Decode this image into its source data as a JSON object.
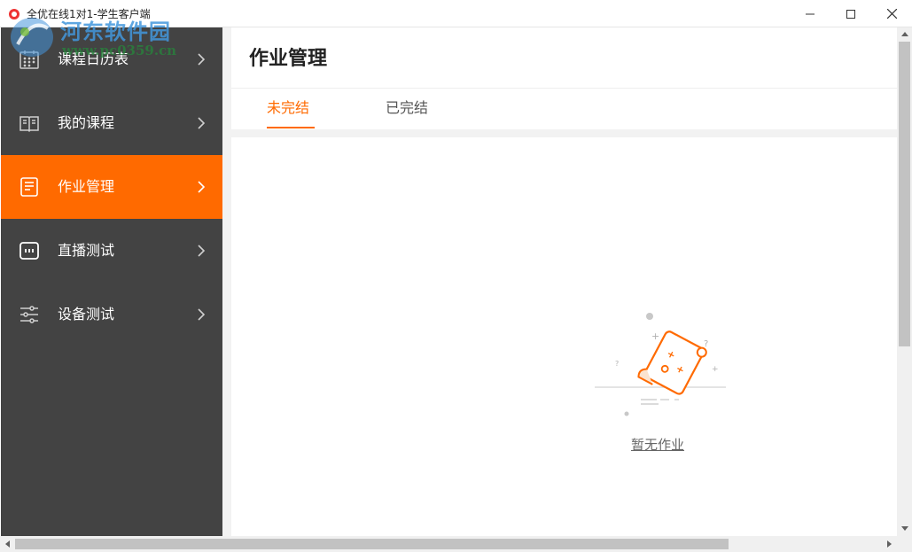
{
  "window": {
    "title": "全优在线1对1-学生客户端"
  },
  "watermark": {
    "name": "河东软件园",
    "url": "www.pc0359.cn"
  },
  "sidebar": {
    "items": [
      {
        "label": "课程日历表",
        "icon": "calendar-icon",
        "active": false
      },
      {
        "label": "我的课程",
        "icon": "book-icon",
        "active": false
      },
      {
        "label": "作业管理",
        "icon": "homework-icon",
        "active": true
      },
      {
        "label": "直播测试",
        "icon": "live-icon",
        "active": false
      },
      {
        "label": "设备测试",
        "icon": "sliders-icon",
        "active": false
      }
    ]
  },
  "main": {
    "title": "作业管理",
    "tabs": [
      {
        "label": "未完结",
        "active": true
      },
      {
        "label": "已完结",
        "active": false
      }
    ],
    "empty_text": "暂无作业"
  },
  "colors": {
    "accent": "#ff6a00",
    "sidebar_bg": "#434343"
  }
}
